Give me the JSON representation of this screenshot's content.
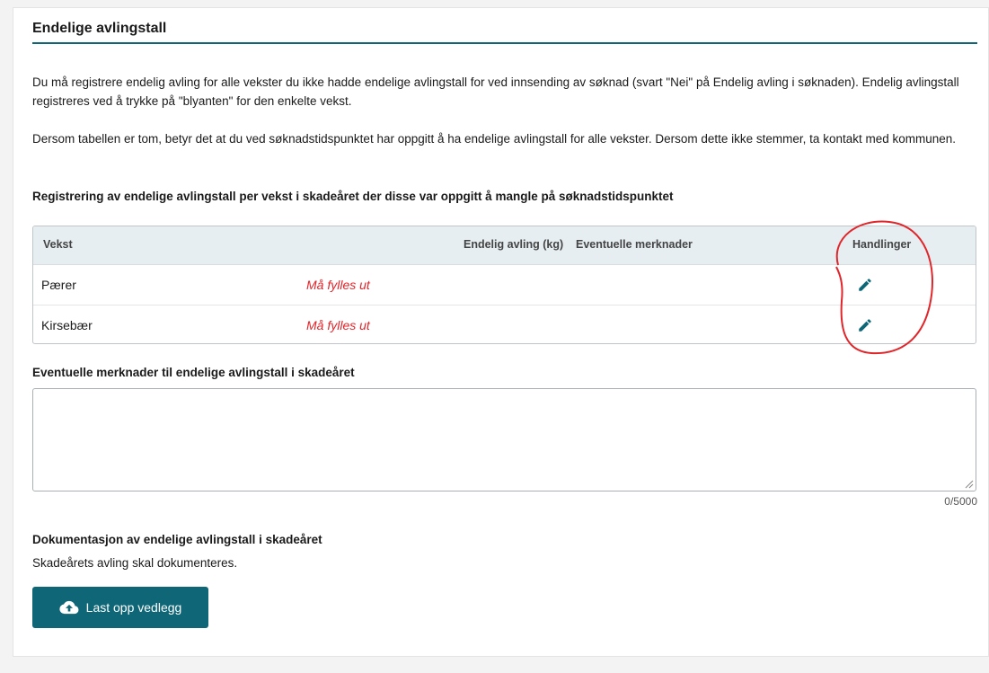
{
  "section": {
    "title": "Endelige avlingstall",
    "intro": "Du må registrere endelig avling for alle vekster du ikke hadde endelige avlingstall for ved innsending av søknad (svart \"Nei\" på Endelig avling i søknaden). Endelig avlingstall registreres ved å trykke på \"blyanten\" for den enkelte vekst.",
    "note": "Dersom tabellen er tom, betyr det at du ved søknadstidspunktet har oppgitt å ha endelige avlingstall for alle vekster. Dersom dette ikke stemmer, ta kontakt med kommunen."
  },
  "table": {
    "heading": "Registrering av endelige avlingstall per vekst i skadeåret der disse var oppgitt å mangle på søknadstidspunktet",
    "columns": {
      "vekst": "Vekst",
      "endelig": "Endelig avling (kg)",
      "merknader": "Eventuelle merknader",
      "handlinger": "Handlinger"
    },
    "rows": [
      {
        "vekst": "Pærer",
        "status": "Må fylles ut"
      },
      {
        "vekst": "Kirsebær",
        "status": "Må fylles ut"
      }
    ]
  },
  "remarks": {
    "label": "Eventuelle merknader til endelige avlingstall i skadeåret",
    "value": "",
    "counter": "0/5000"
  },
  "documentation": {
    "heading": "Dokumentasjon av endelige avlingstall i skadeåret",
    "text": "Skadeårets avling skal dokumenteres.",
    "upload_label": "Last opp vedlegg"
  },
  "icons": {
    "edit": "pencil-icon",
    "upload": "cloud-upload-icon"
  },
  "colors": {
    "accent": "#0e6677",
    "required": "#e2242a",
    "annotation": "#e0262a"
  }
}
